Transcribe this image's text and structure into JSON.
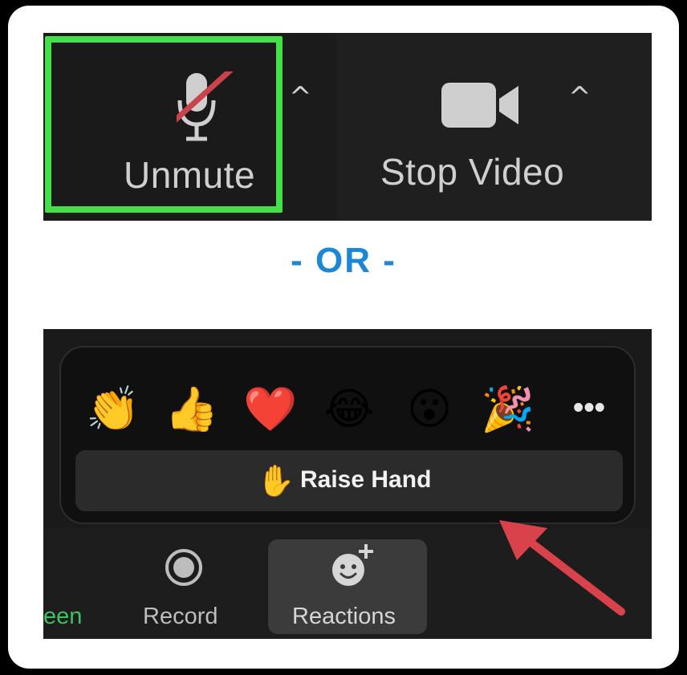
{
  "top_toolbar": {
    "unmute_label": "Unmute",
    "stop_video_label": "Stop Video",
    "caret": "^",
    "highlight_color": "#44e04a"
  },
  "divider_text": "- OR -",
  "reactions_popup": {
    "emojis": [
      "👏",
      "👍",
      "❤️",
      "😂",
      "😮",
      "🎉"
    ],
    "more": "•••",
    "raise_hand_icon": "✋",
    "raise_hand_label": "Raise Hand"
  },
  "bottom_toolbar": {
    "screen_label_fragment": "een",
    "record_label": "Record",
    "reactions_label": "Reactions"
  },
  "accent_color": "#1b87d6",
  "arrow_color": "#d9424a"
}
